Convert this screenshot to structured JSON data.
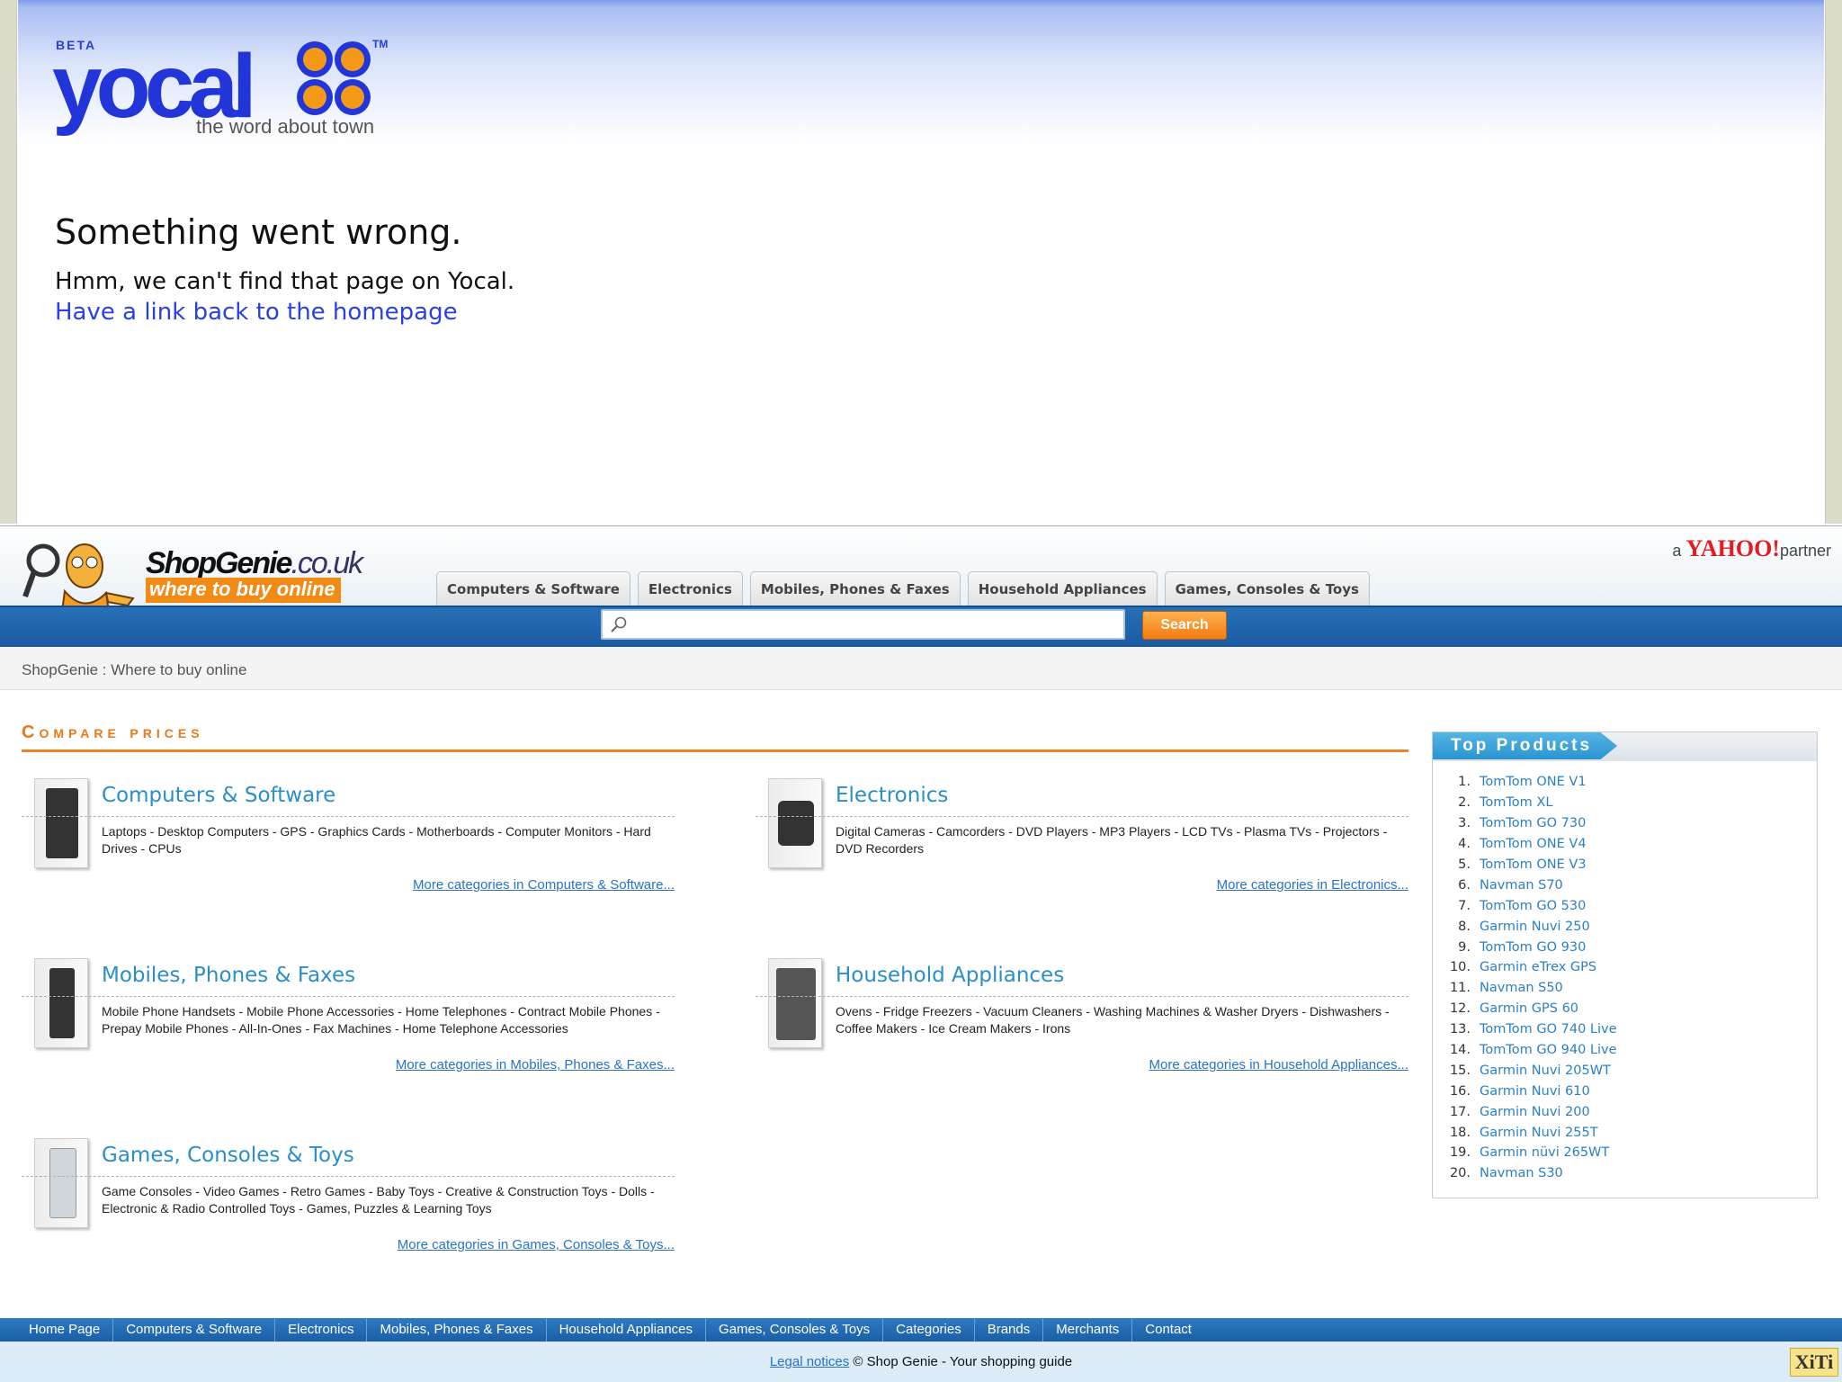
{
  "yocal": {
    "logo": {
      "beta": "BETA",
      "wordmark": "yocal",
      "tm": "TM",
      "tagline": "the word about town"
    },
    "error_title": "Something went wrong.",
    "error_message": "Hmm, we can't find that page on Yocal.",
    "home_link": "Have a link back to the homepage",
    "colors": {
      "brand_blue": "#2235d8",
      "logo_dots": "#f59a16"
    }
  },
  "shopgenie": {
    "brand": {
      "name": "ShopGenie",
      "domain": ".co.uk",
      "slogan": "where to buy online"
    },
    "partner": {
      "prefix": "a",
      "yahoo": "YAHOO!",
      "suffix": "partner"
    },
    "tabs": [
      {
        "label": "Computers & Software"
      },
      {
        "label": "Electronics"
      },
      {
        "label": "Mobiles, Phones & Faxes"
      },
      {
        "label": "Household Appliances"
      },
      {
        "label": "Games, Consoles & Toys"
      }
    ],
    "search": {
      "value": "",
      "placeholder": "",
      "button_label": "Search"
    },
    "breadcrumb": "ShopGenie : Where to buy online",
    "compare_title": "Compare prices",
    "categories": [
      {
        "title": "Computers & Software",
        "subs": "Laptops - Desktop Computers - GPS - Graphics Cards - Motherboards - Computer Monitors - Hard Drives - CPUs",
        "more": "More categories in Computers & Software..."
      },
      {
        "title": "Electronics",
        "subs": "Digital Cameras - Camcorders - DVD Players - MP3 Players - LCD TVs - Plasma TVs - Projectors - DVD Recorders",
        "more": "More categories in Electronics..."
      },
      {
        "title": "Mobiles, Phones & Faxes",
        "subs": "Mobile Phone Handsets - Mobile Phone Accessories - Home Telephones - Contract Mobile Phones - Prepay Mobile Phones - All-In-Ones - Fax Machines - Home Telephone Accessories",
        "more": "More categories in Mobiles, Phones & Faxes..."
      },
      {
        "title": "Household Appliances",
        "subs": "Ovens - Fridge Freezers - Vacuum Cleaners - Washing Machines & Washer Dryers - Dishwashers - Coffee Makers - Ice Cream Makers - Irons",
        "more": "More categories in Household Appliances..."
      },
      {
        "title": "Games, Consoles & Toys",
        "subs": "Game Consoles - Video Games - Retro Games - Baby Toys - Creative & Construction Toys - Dolls - Electronic & Radio Controlled Toys - Games, Puzzles & Learning Toys",
        "more": "More categories in Games, Consoles & Toys..."
      }
    ],
    "top_products": {
      "title": "Top Products",
      "items": [
        {
          "n": "1.",
          "name": "TomTom ONE V1"
        },
        {
          "n": "2.",
          "name": "TomTom XL"
        },
        {
          "n": "3.",
          "name": "TomTom GO 730"
        },
        {
          "n": "4.",
          "name": "TomTom ONE V4"
        },
        {
          "n": "5.",
          "name": "TomTom ONE V3"
        },
        {
          "n": "6.",
          "name": "Navman S70"
        },
        {
          "n": "7.",
          "name": "TomTom GO 530"
        },
        {
          "n": "8.",
          "name": "Garmin Nuvi 250"
        },
        {
          "n": "9.",
          "name": "TomTom GO 930"
        },
        {
          "n": "10.",
          "name": "Garmin eTrex GPS"
        },
        {
          "n": "11.",
          "name": "Navman S50"
        },
        {
          "n": "12.",
          "name": "Garmin GPS 60"
        },
        {
          "n": "13.",
          "name": "TomTom GO 740 Live"
        },
        {
          "n": "14.",
          "name": "TomTom GO 940 Live"
        },
        {
          "n": "15.",
          "name": "Garmin Nuvi 205WT"
        },
        {
          "n": "16.",
          "name": "Garmin Nuvi 610"
        },
        {
          "n": "17.",
          "name": "Garmin Nuvi 200"
        },
        {
          "n": "18.",
          "name": "Garmin Nuvi 255T"
        },
        {
          "n": "19.",
          "name": "Garmin nüvi 265WT"
        },
        {
          "n": "20.",
          "name": "Navman S30"
        }
      ]
    },
    "footer_nav": [
      {
        "label": "Home Page"
      },
      {
        "label": "Computers & Software"
      },
      {
        "label": "Electronics"
      },
      {
        "label": "Mobiles, Phones & Faxes"
      },
      {
        "label": "Household Appliances"
      },
      {
        "label": "Games, Consoles & Toys"
      },
      {
        "label": "Categories"
      },
      {
        "label": "Brands"
      },
      {
        "label": "Merchants"
      },
      {
        "label": "Contact"
      }
    ],
    "legal": {
      "link": "Legal notices",
      "text": " © Shop Genie - Your shopping guide"
    },
    "xiti": "XiTi",
    "colors": {
      "accent_orange": "#e8781a",
      "nav_blue": "#1b5aa3",
      "link_blue": "#2a8ec9"
    }
  }
}
